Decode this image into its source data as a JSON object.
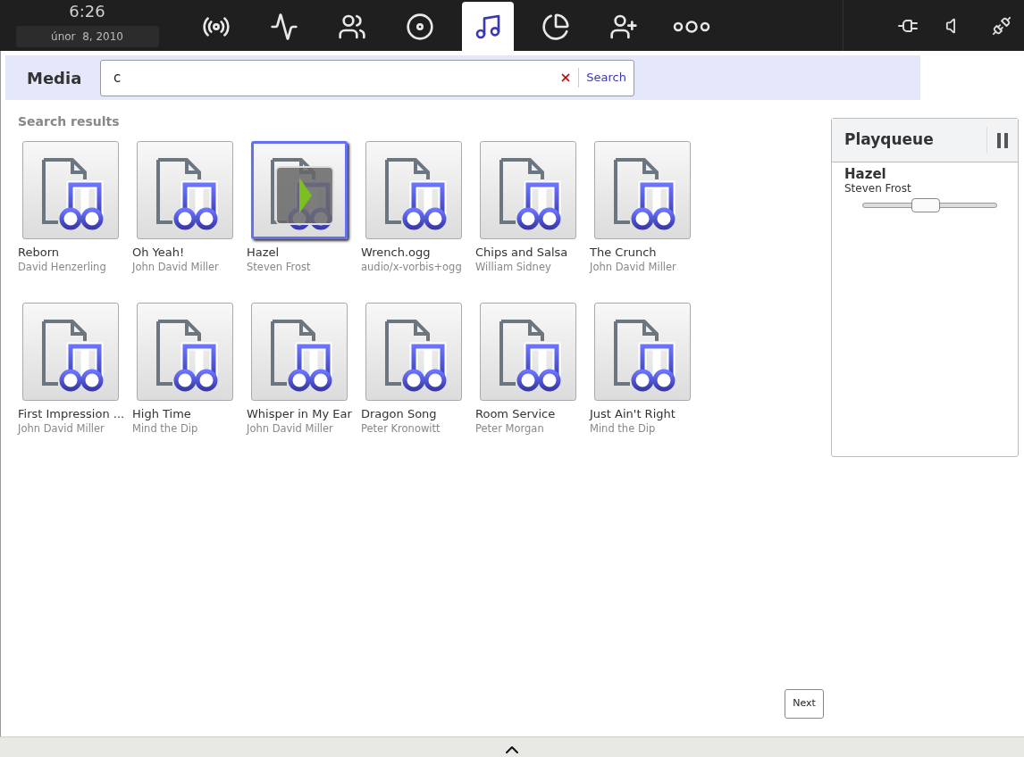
{
  "clock": {
    "time": "6:26",
    "date": "únor  8, 2010"
  },
  "nav_tabs": [
    {
      "selected": false
    },
    {
      "selected": false
    },
    {
      "selected": false
    },
    {
      "selected": false
    },
    {
      "selected": true
    },
    {
      "selected": false
    },
    {
      "selected": false
    },
    {
      "selected": false
    }
  ],
  "media_bar": {
    "title": "Media",
    "search": {
      "value": "c",
      "button": "Search"
    }
  },
  "results": {
    "heading": "Search results",
    "items": [
      {
        "title": "Reborn",
        "subtitle": "David Henzerling",
        "selected": false
      },
      {
        "title": "Oh Yeah!",
        "subtitle": "John David Miller",
        "selected": false
      },
      {
        "title": "Hazel",
        "subtitle": "Steven Frost",
        "selected": true
      },
      {
        "title": "Wrench.ogg",
        "subtitle": "audio/x-vorbis+ogg",
        "selected": false
      },
      {
        "title": "Chips and Salsa",
        "subtitle": "William Sidney",
        "selected": false
      },
      {
        "title": "The Crunch",
        "subtitle": "John David Miller",
        "selected": false
      },
      {
        "title": "First Impression ...",
        "subtitle": "John David Miller",
        "selected": false
      },
      {
        "title": "High Time",
        "subtitle": "Mind the Dip",
        "selected": false
      },
      {
        "title": "Whisper in My Ear",
        "subtitle": "John David Miller",
        "selected": false
      },
      {
        "title": "Dragon Song",
        "subtitle": "Peter Kronowitt",
        "selected": false
      },
      {
        "title": "Room Service",
        "subtitle": "Peter Morgan",
        "selected": false
      },
      {
        "title": "Just Ain't Right",
        "subtitle": "Mind the Dip",
        "selected": false
      }
    ],
    "next_button": "Next"
  },
  "playqueue": {
    "title": "Playqueue",
    "track": {
      "title": "Hazel",
      "artist": "Steven Frost",
      "level": 0.47
    }
  }
}
